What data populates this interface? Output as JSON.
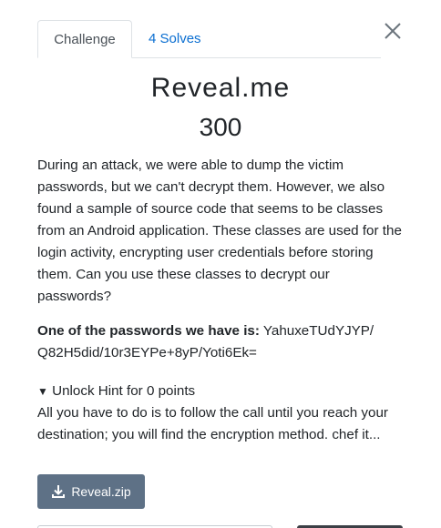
{
  "tabs": [
    {
      "label": "Challenge",
      "active": true
    },
    {
      "label": "4 Solves",
      "active": false
    }
  ],
  "challenge": {
    "title": "Reveal.me",
    "points": "300",
    "description": "During an attack, we were able to dump the victim passwords, but we can't decrypt them. However, we also found a sample of source code that seems to be classes from an Android application. These classes are used for the login activity, encrypting user credentials before storing them. Can you use these classes to decrypt our passwords?",
    "password_label": "One of the passwords we have is:",
    "password_value": "YahuxeTUdYJYP/\nQ82H5did/10r3EYPe+8yP/Yoti6Ek="
  },
  "hint": {
    "toggle_label": "Unlock Hint for 0 points",
    "text": "All you have to do is to follow the call until you reach your destination; you will find the encryption method. chef it..."
  },
  "file": {
    "label": "Reveal.zip"
  },
  "colors": {
    "link": "#0a6ed1",
    "button": "#5e7186"
  }
}
